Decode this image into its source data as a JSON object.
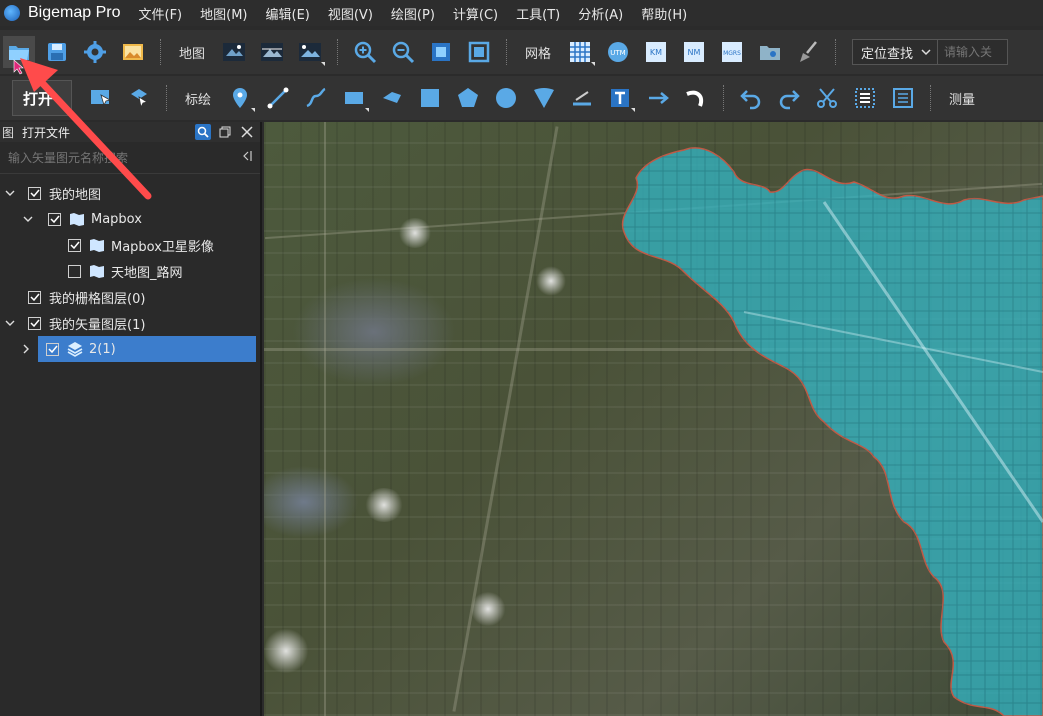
{
  "app": {
    "title": "Bigemap Pro"
  },
  "menu": [
    "文件(F)",
    "地图(M)",
    "编辑(E)",
    "视图(V)",
    "绘图(P)",
    "计算(C)",
    "工具(T)",
    "分析(A)",
    "帮助(H)"
  ],
  "toolbar1": {
    "map_label": "地图",
    "grid_label": "网格",
    "locate_label": "定位查找",
    "locate_placeholder": "请输入关",
    "grid_buttons": [
      "UTM",
      "KM",
      "NM",
      "MGRS"
    ]
  },
  "toolbar2": {
    "open_tooltip": "打开",
    "annotate_label": "标绘",
    "measure_label": "测量"
  },
  "panel": {
    "tab_stub": "图",
    "title": "打开文件",
    "search_placeholder": "输入矢量图元名称搜索",
    "collapse_icon": "collapse-left-icon"
  },
  "tree": [
    {
      "label": "我的地图",
      "checked": true,
      "expanded": true
    },
    {
      "label": "Mapbox",
      "checked": true,
      "expanded": true
    },
    {
      "label": "Mapbox卫星影像",
      "checked": true
    },
    {
      "label": "天地图_路网",
      "checked": false
    },
    {
      "label": "我的栅格图层(0)",
      "checked": true
    },
    {
      "label": "我的矢量图层(1)",
      "checked": true,
      "expanded": true
    },
    {
      "label": "2(1)",
      "checked": true,
      "selected": true,
      "expanded": false
    }
  ],
  "colors": {
    "selection": "#3c7dcc",
    "overlay_fill": "#33b3c2",
    "overlay_stroke": "#c05a46",
    "arrow": "#ff4b4b"
  }
}
